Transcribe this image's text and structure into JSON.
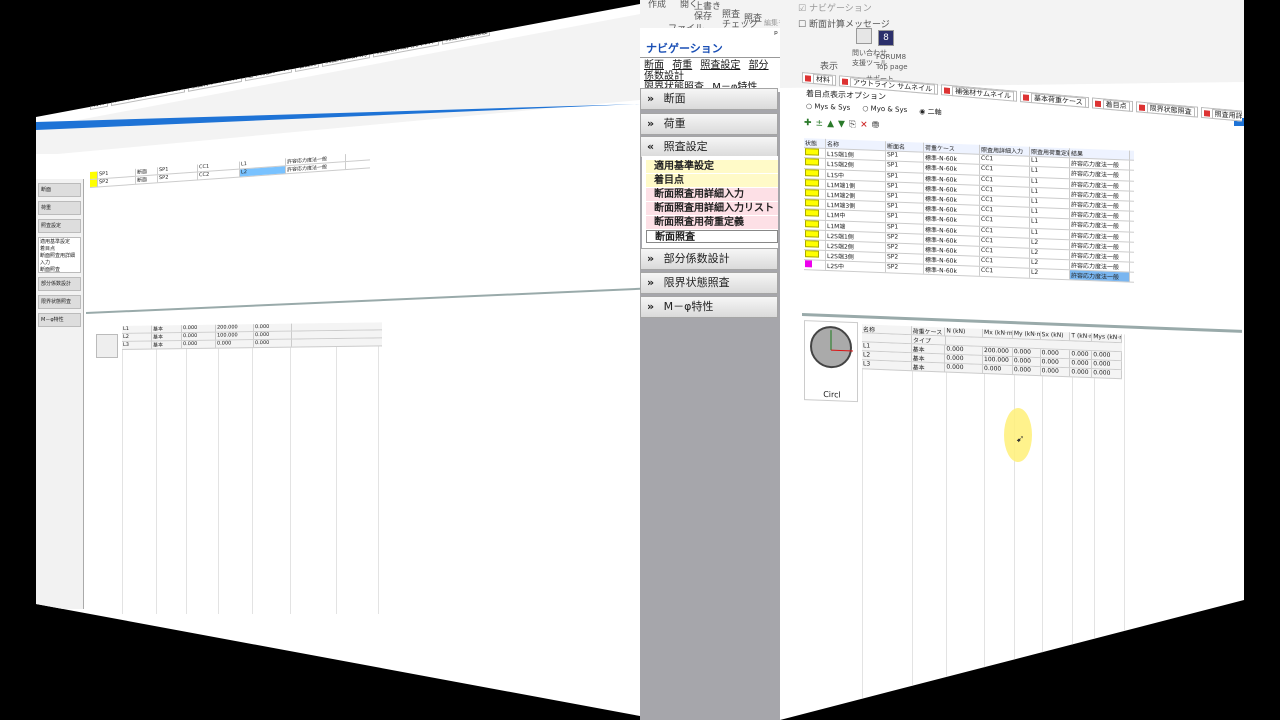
{
  "ribbon_top": {
    "group_file": "ファイル",
    "btn_create": "作成",
    "btn_open": "開く",
    "btn_overwrite_save": "上書き\n保存",
    "btn_check": "照査\nチェック",
    "btn_verify": "照査",
    "btn_return_edit": "編集モード\nに戻る",
    "group_verify": "照査",
    "chk_navigation": "ナビゲーション",
    "chk_section_msg": "断面計算メッセージ",
    "group_display": "表示",
    "btn_inquiry": "問い合わせ\n支援ツール",
    "btn_forum": "FORUM8\nTop page",
    "group_support": "サポート"
  },
  "navigation": {
    "title": "ナビゲーション",
    "links": [
      "断面",
      "荷重",
      "照査設定",
      "部分係数設計",
      "限界状態照査",
      "M－φ特性"
    ],
    "sections": [
      {
        "label": "断面",
        "chevron": "»"
      },
      {
        "label": "荷重",
        "chevron": "»"
      },
      {
        "label": "照査設定",
        "chevron": "«"
      },
      {
        "label": "部分係数設計",
        "chevron": "»"
      },
      {
        "label": "限界状態照査",
        "chevron": "»"
      },
      {
        "label": "M－φ特性",
        "chevron": "»"
      }
    ],
    "subitems": [
      "適用基準設定",
      "着目点",
      "断面照査用詳細入力",
      "断面照査用詳細入力リスト",
      "断面照査用荷重定義",
      "断面照査"
    ]
  },
  "right_window": {
    "tabs": [
      "材料",
      "アウトライン サムネイル",
      "補強材サムネイル",
      "基本荷重ケース",
      "着目点",
      "限界状態照査",
      "照査用詳細入力",
      "照査用詳細入力リスト",
      "照査用荷重定義"
    ],
    "options_label": "着目点表示オプション",
    "radios": [
      "Mys & Sys",
      "Myo & Sys",
      "二軸"
    ],
    "grid_header": [
      "状態",
      "名称",
      "断面名",
      "荷重ケース",
      "照査用詳細入力",
      "照査用荷重定義",
      "結果"
    ],
    "grid_rows": [
      {
        "name": "L1S端1側",
        "sec": "SP1",
        "case": "標準-N-60k",
        "detail": "CC1",
        "def": "L1",
        "result": "許容応力度法一般"
      },
      {
        "name": "L1S端2側",
        "sec": "SP1",
        "case": "標準-N-60k",
        "detail": "CC1",
        "def": "L1",
        "result": "許容応力度法一般"
      },
      {
        "name": "L1S中",
        "sec": "SP1",
        "case": "標準-N-60k",
        "detail": "CC1",
        "def": "L1",
        "result": "許容応力度法一般"
      },
      {
        "name": "L1M端1側",
        "sec": "SP1",
        "case": "標準-N-60k",
        "detail": "CC1",
        "def": "L1",
        "result": "許容応力度法一般"
      },
      {
        "name": "L1M端2側",
        "sec": "SP1",
        "case": "標準-N-60k",
        "detail": "CC1",
        "def": "L1",
        "result": "許容応力度法一般"
      },
      {
        "name": "L1M端3側",
        "sec": "SP1",
        "case": "標準-N-60k",
        "detail": "CC1",
        "def": "L1",
        "result": "許容応力度法一般"
      },
      {
        "name": "L1M中",
        "sec": "SP1",
        "case": "標準-N-60k",
        "detail": "CC1",
        "def": "L1",
        "result": "許容応力度法一般"
      },
      {
        "name": "L1M端",
        "sec": "SP1",
        "case": "標準-N-60k",
        "detail": "CC1",
        "def": "L1",
        "result": "許容応力度法一般"
      },
      {
        "name": "L2S端1側",
        "sec": "SP2",
        "case": "標準-N-60k",
        "detail": "CC1",
        "def": "L2",
        "result": "許容応力度法一般"
      },
      {
        "name": "L2S端2側",
        "sec": "SP2",
        "case": "標準-N-60k",
        "detail": "CC1",
        "def": "L2",
        "result": "許容応力度法一般"
      },
      {
        "name": "L2S端3側",
        "sec": "SP2",
        "case": "標準-N-60k",
        "detail": "CC1",
        "def": "L2",
        "result": "許容応力度法一般"
      },
      {
        "name": "L2S中",
        "sec": "SP2",
        "case": "標準-N-60k",
        "detail": "CC1",
        "def": "L2",
        "result": "許容応力度法一般"
      }
    ],
    "load_header": [
      "名称",
      "荷重ケース",
      "N (kN)",
      "Mx (kN·m)",
      "My (kN·m)",
      "Sx (kN)",
      "T (kN·m)",
      "Mys (kN·m)",
      "Myo (kN·m)"
    ],
    "load_type": "タイプ",
    "load_rows": [
      {
        "name": "L1",
        "type": "基本",
        "n": "0.000",
        "mx": "200.000",
        "my": "0.000",
        "sx": "0.000",
        "t": "0.000",
        "mys": "0.000",
        "myo": "0.000"
      },
      {
        "name": "L2",
        "type": "基本",
        "n": "0.000",
        "mx": "100.000",
        "my": "0.000",
        "sx": "0.000",
        "t": "0.000",
        "mys": "0.000",
        "myo": "0.000"
      },
      {
        "name": "L3",
        "type": "基本",
        "n": "0.000",
        "mx": "0.000",
        "my": "0.000",
        "sx": "0.000",
        "t": "0.000",
        "mys": "0.000",
        "myo": "0.000"
      }
    ],
    "circle_label": "Circl"
  },
  "left_window": {
    "grid_rows": [
      {
        "name": "SP1",
        "sec": "断面",
        "case": "SP1",
        "detail": "CC1",
        "def": "L1",
        "result": "許容応力度法一般"
      },
      {
        "name": "SP2",
        "sec": "断面",
        "case": "SP2",
        "detail": "CC2",
        "def": "L2",
        "result": "許容応力度法一般"
      }
    ],
    "load_rows": [
      {
        "name": "L1",
        "type": "基本",
        "n": "0.000",
        "mx": "200.000",
        "my": "0.000"
      },
      {
        "name": "L2",
        "type": "基本",
        "n": "0.000",
        "mx": "100.000",
        "my": "0.000"
      },
      {
        "name": "L3",
        "type": "基本",
        "n": "0.000",
        "mx": "0.000",
        "my": "0.000"
      }
    ],
    "circle_label": "Circl"
  }
}
